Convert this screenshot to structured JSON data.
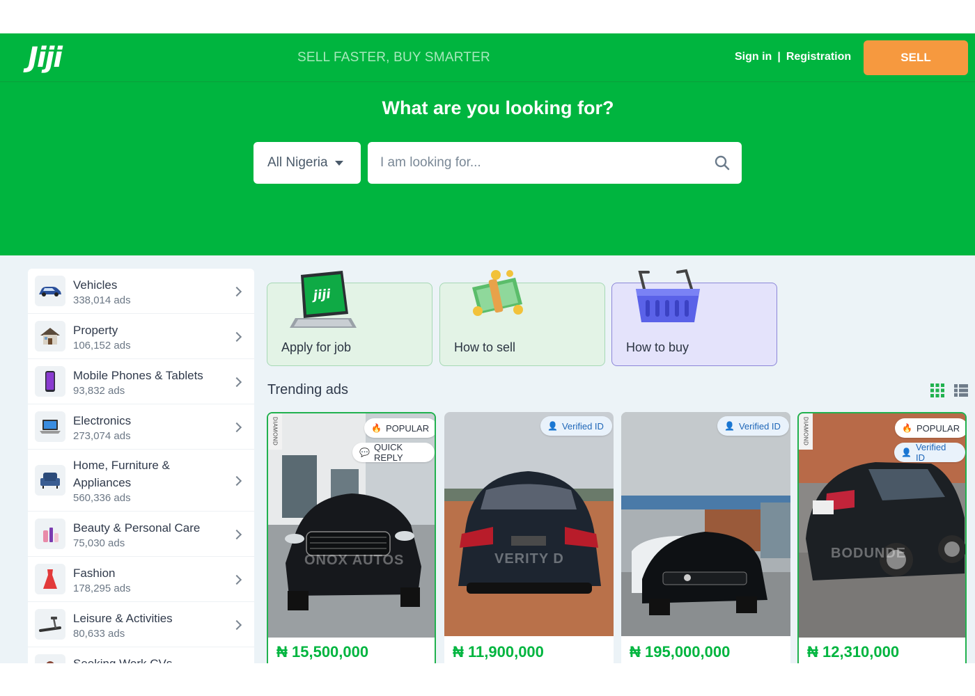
{
  "header": {
    "logo": "Jiji",
    "tagline": "SELL FASTER, BUY SMARTER",
    "sign_in": "Sign in",
    "separator": "|",
    "registration": "Registration",
    "sell": "SELL"
  },
  "hero": {
    "title": "What are you looking for?",
    "region": "All Nigeria",
    "search_placeholder": "I am looking for..."
  },
  "categories": [
    {
      "name": "Vehicles",
      "count": "338,014 ads",
      "icon": "car-icon"
    },
    {
      "name": "Property",
      "count": "106,152 ads",
      "icon": "house-icon"
    },
    {
      "name": "Mobile Phones & Tablets",
      "count": "93,832 ads",
      "icon": "phone-icon"
    },
    {
      "name": "Electronics",
      "count": "273,074 ads",
      "icon": "laptop-icon"
    },
    {
      "name": "Home, Furniture & Appliances",
      "count": "560,336 ads",
      "icon": "armchair-icon"
    },
    {
      "name": "Beauty & Personal Care",
      "count": "75,030 ads",
      "icon": "cosmetics-icon"
    },
    {
      "name": "Fashion",
      "count": "178,295 ads",
      "icon": "dress-icon"
    },
    {
      "name": "Leisure & Activities",
      "count": "80,633 ads",
      "icon": "treadmill-icon"
    },
    {
      "name": "Seeking Work CVs",
      "count": "",
      "icon": "person-icon"
    }
  ],
  "promos": [
    {
      "label": "Apply for job",
      "image_text": "jiji"
    },
    {
      "label": "How to sell"
    },
    {
      "label": "How to buy"
    }
  ],
  "trending": {
    "title": "Trending ads"
  },
  "ads": [
    {
      "price": "₦ 15,500,000",
      "diamond": "DIAMOND",
      "badge1": "POPULAR",
      "badge2": "QUICK REPLY",
      "watermark": "ONOX AUTOS"
    },
    {
      "price": "₦ 11,900,000",
      "badge1": "Verified ID",
      "watermark": "VERITY D"
    },
    {
      "price": "₦ 195,000,000",
      "badge1": "Verified ID"
    },
    {
      "price": "₦ 12,310,000",
      "diamond": "DIAMOND",
      "badge1": "POPULAR",
      "badge2": "Verified ID",
      "watermark": "BODUNDE"
    }
  ],
  "colors": {
    "brand_green": "#00b53f",
    "sell_orange": "#f6993f",
    "background": "#ecf3f7"
  }
}
